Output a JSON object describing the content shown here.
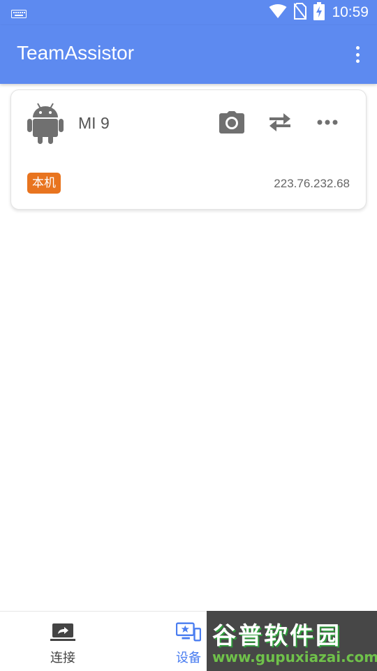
{
  "statusbar": {
    "time": "10:59",
    "icons": [
      "keyboard-icon",
      "wifi-icon",
      "no-sim-icon",
      "battery-charging-icon"
    ]
  },
  "appbar": {
    "title": "TeamAssistor",
    "menu_icon": "overflow-menu-icon"
  },
  "devices": [
    {
      "icon": "android-icon",
      "name": "MI 9",
      "badge": "本机",
      "ip": "223.76.232.68",
      "actions": [
        "camera-icon",
        "swap-arrows-icon",
        "more-horizontal-icon"
      ]
    }
  ],
  "bottom_nav": {
    "items": [
      {
        "label": "连接",
        "icon": "screen-share-icon",
        "active": false
      },
      {
        "label": "设备",
        "icon": "devices-icon",
        "active": true
      },
      {
        "label": "",
        "icon": "",
        "active": false
      }
    ]
  },
  "watermark": {
    "title": "谷普软件园",
    "url": "www.gupuxiazai.com"
  },
  "colors": {
    "primary": "#5d8af0",
    "badge": "#e8741f",
    "active_nav": "#4a7df0",
    "icon_gray": "#707070"
  }
}
